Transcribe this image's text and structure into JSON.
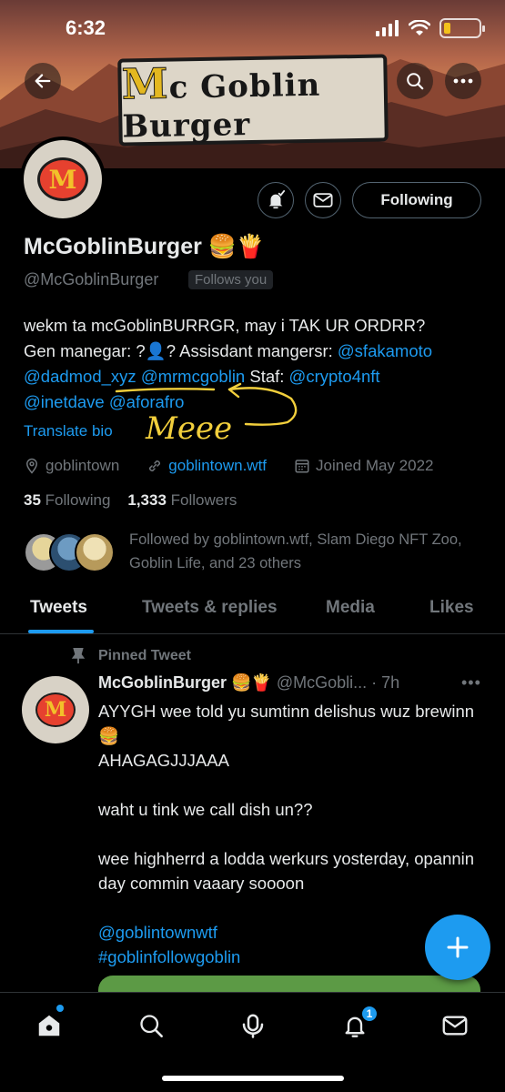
{
  "status_bar": {
    "time": "6:32"
  },
  "banner": {
    "logo_text_m": "M",
    "logo_text_rest": "c Goblin Burger",
    "logo_alt": "McGoblinBurger banner"
  },
  "profile": {
    "display_name": "McGoblinBurger 🍔🍟",
    "handle": "@McGoblinBurger",
    "follows_you": "Follows you",
    "following_button": "Following",
    "bio": {
      "line1": "wekm ta mcGoblinBURRGR, may i TAK UR ORDRR?",
      "line2_pre": "Gen manegar: ?👤? Assisdant mangersr: ",
      "mention1": "@sfakamoto",
      "mention2": "@dadmod_xyz",
      "mention3": "@mrmcgoblin",
      "staf": " Staf: ",
      "mention4": "@crypto4nft",
      "mention5": "@inetdave",
      "mention6": "@aforafro"
    },
    "annotation": "Meee",
    "translate_bio": "Translate bio",
    "location": "goblintown",
    "website": "goblintown.wtf",
    "joined": "Joined May 2022",
    "following_count": "35",
    "following_label": "Following",
    "followers_count": "1,333",
    "followers_label": "Followers",
    "followed_by": "Followed by goblintown.wtf, Slam Diego NFT Zoo, Goblin Life, and 23 others"
  },
  "tabs": [
    {
      "label": "Tweets",
      "active": true
    },
    {
      "label": "Tweets & replies",
      "active": false
    },
    {
      "label": "Media",
      "active": false
    },
    {
      "label": "Likes",
      "active": false
    }
  ],
  "tweet": {
    "pinned_label": "Pinned Tweet",
    "author_name": "McGoblinBurger 🍔🍟",
    "author_handle_time": "@McGobli... · 7h",
    "line1": "AYYGH wee told yu sumtinn delishus wuz brewinn 🍔",
    "line2": "AHAGAGJJJAAA",
    "line3": "waht u tink we call dish un??",
    "line4": "wee highherrd a lodda werkurs yosterday, opannin day commin vaaary soooon",
    "mention": "@goblintownwtf",
    "hashtag": "#goblinfollowgoblin"
  },
  "nav": {
    "notification_count": "1"
  },
  "colors": {
    "accent": "#1d9bf0",
    "background": "#000000",
    "muted": "#71767b",
    "text": "#e7e9ea"
  }
}
